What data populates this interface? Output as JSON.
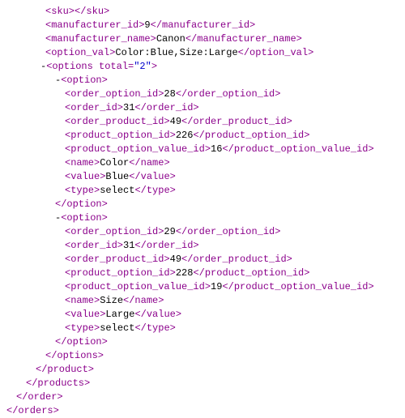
{
  "lines": [
    {
      "indent": "i1",
      "parts": [
        {
          "t": "tag",
          "v": "<sku>"
        },
        {
          "t": "tag",
          "v": "</sku>"
        }
      ]
    },
    {
      "indent": "i1",
      "parts": [
        {
          "t": "tag",
          "v": "<manufacturer_id>"
        },
        {
          "t": "text",
          "v": "9"
        },
        {
          "t": "tag",
          "v": "</manufacturer_id>"
        }
      ]
    },
    {
      "indent": "i1",
      "parts": [
        {
          "t": "tag",
          "v": "<manufacturer_name>"
        },
        {
          "t": "text",
          "v": "Canon"
        },
        {
          "t": "tag",
          "v": "</manufacturer_name>"
        }
      ]
    },
    {
      "indent": "i1",
      "parts": [
        {
          "t": "tag",
          "v": "<option_val>"
        },
        {
          "t": "text",
          "v": "Color:Blue,Size:Large"
        },
        {
          "t": "tag",
          "v": "</option_val>"
        }
      ]
    },
    {
      "indent": "i2",
      "parts": [
        {
          "t": "text",
          "v": "-"
        },
        {
          "t": "tag",
          "v": "<options "
        },
        {
          "t": "attr-name",
          "v": "total="
        },
        {
          "t": "attr-val",
          "v": "\"2\""
        },
        {
          "t": "tag",
          "v": ">"
        }
      ]
    },
    {
      "indent": "i3",
      "parts": [
        {
          "t": "text",
          "v": "-"
        },
        {
          "t": "tag",
          "v": "<option>"
        }
      ]
    },
    {
      "indent": "i4",
      "parts": [
        {
          "t": "tag",
          "v": "<order_option_id>"
        },
        {
          "t": "text",
          "v": "28"
        },
        {
          "t": "tag",
          "v": "</order_option_id>"
        }
      ]
    },
    {
      "indent": "i4",
      "parts": [
        {
          "t": "tag",
          "v": "<order_id>"
        },
        {
          "t": "text",
          "v": "31"
        },
        {
          "t": "tag",
          "v": "</order_id>"
        }
      ]
    },
    {
      "indent": "i4",
      "parts": [
        {
          "t": "tag",
          "v": "<order_product_id>"
        },
        {
          "t": "text",
          "v": "49"
        },
        {
          "t": "tag",
          "v": "</order_product_id>"
        }
      ]
    },
    {
      "indent": "i4",
      "parts": [
        {
          "t": "tag",
          "v": "<product_option_id>"
        },
        {
          "t": "text",
          "v": "226"
        },
        {
          "t": "tag",
          "v": "</product_option_id>"
        }
      ]
    },
    {
      "indent": "i4",
      "parts": [
        {
          "t": "tag",
          "v": "<product_option_value_id>"
        },
        {
          "t": "text",
          "v": "16"
        },
        {
          "t": "tag",
          "v": "</product_option_value_id>"
        }
      ]
    },
    {
      "indent": "i4",
      "parts": [
        {
          "t": "tag",
          "v": "<name>"
        },
        {
          "t": "text",
          "v": "Color"
        },
        {
          "t": "tag",
          "v": "</name>"
        }
      ]
    },
    {
      "indent": "i4",
      "parts": [
        {
          "t": "tag",
          "v": "<value>"
        },
        {
          "t": "text",
          "v": "Blue"
        },
        {
          "t": "tag",
          "v": "</value>"
        }
      ]
    },
    {
      "indent": "i4",
      "parts": [
        {
          "t": "tag",
          "v": "<type>"
        },
        {
          "t": "text",
          "v": "select"
        },
        {
          "t": "tag",
          "v": "</type>"
        }
      ]
    },
    {
      "indent": "i3",
      "parts": [
        {
          "t": "tag",
          "v": " </option>"
        }
      ]
    },
    {
      "indent": "i3",
      "parts": [
        {
          "t": "text",
          "v": "-"
        },
        {
          "t": "tag",
          "v": "<option>"
        }
      ]
    },
    {
      "indent": "i4",
      "parts": [
        {
          "t": "tag",
          "v": "<order_option_id>"
        },
        {
          "t": "text",
          "v": "29"
        },
        {
          "t": "tag",
          "v": "</order_option_id>"
        }
      ]
    },
    {
      "indent": "i4",
      "parts": [
        {
          "t": "tag",
          "v": "<order_id>"
        },
        {
          "t": "text",
          "v": "31"
        },
        {
          "t": "tag",
          "v": "</order_id>"
        }
      ]
    },
    {
      "indent": "i4",
      "parts": [
        {
          "t": "tag",
          "v": "<order_product_id>"
        },
        {
          "t": "text",
          "v": "49"
        },
        {
          "t": "tag",
          "v": "</order_product_id>"
        }
      ]
    },
    {
      "indent": "i4",
      "parts": [
        {
          "t": "tag",
          "v": "<product_option_id>"
        },
        {
          "t": "text",
          "v": "228"
        },
        {
          "t": "tag",
          "v": "</product_option_id>"
        }
      ]
    },
    {
      "indent": "i4",
      "parts": [
        {
          "t": "tag",
          "v": "<product_option_value_id>"
        },
        {
          "t": "text",
          "v": "19"
        },
        {
          "t": "tag",
          "v": "</product_option_value_id>"
        }
      ]
    },
    {
      "indent": "i4",
      "parts": [
        {
          "t": "tag",
          "v": "<name>"
        },
        {
          "t": "text",
          "v": "Size"
        },
        {
          "t": "tag",
          "v": "</name>"
        }
      ]
    },
    {
      "indent": "i4",
      "parts": [
        {
          "t": "tag",
          "v": "<value>"
        },
        {
          "t": "text",
          "v": "Large"
        },
        {
          "t": "tag",
          "v": "</value>"
        }
      ]
    },
    {
      "indent": "i4",
      "parts": [
        {
          "t": "tag",
          "v": "<type>"
        },
        {
          "t": "text",
          "v": "select"
        },
        {
          "t": "tag",
          "v": "</type>"
        }
      ]
    },
    {
      "indent": "i3",
      "parts": [
        {
          "t": "tag",
          "v": " </option>"
        }
      ]
    },
    {
      "indent": "i1",
      "parts": [
        {
          "t": "tag",
          "v": "</options>"
        }
      ]
    },
    {
      "indent": "c4",
      "parts": [
        {
          "t": "tag",
          "v": "</product>"
        }
      ]
    },
    {
      "indent": "c3",
      "parts": [
        {
          "t": "tag",
          "v": "</products>"
        }
      ]
    },
    {
      "indent": "c2",
      "parts": [
        {
          "t": "tag",
          "v": "</order>"
        }
      ]
    },
    {
      "indent": "c1",
      "parts": [
        {
          "t": "tag",
          "v": "</orders>"
        }
      ]
    }
  ]
}
